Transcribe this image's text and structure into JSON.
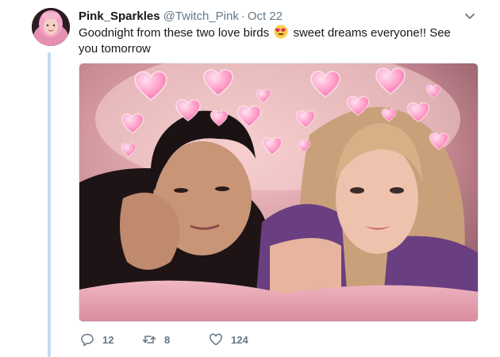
{
  "tweet": {
    "display_name": "Pink_Sparkles",
    "handle": "@Twitch_Pink",
    "separator": "·",
    "time": "Oct 22",
    "text_before_emoji": "Goodnight from these two love birds",
    "emoji": "heart-eyes-emoji",
    "text_after_emoji": "sweet dreams everyone!! See you tomorrow",
    "media": {
      "description_icon": "selfie-photo",
      "filter": "heart-crown-filter"
    },
    "actions": {
      "reply_count": "12",
      "retweet_count": "8",
      "like_count": "124"
    }
  },
  "colors": {
    "thread_line": "#c4dbef",
    "secondary_text": "#657786",
    "primary_text": "#14171a"
  }
}
